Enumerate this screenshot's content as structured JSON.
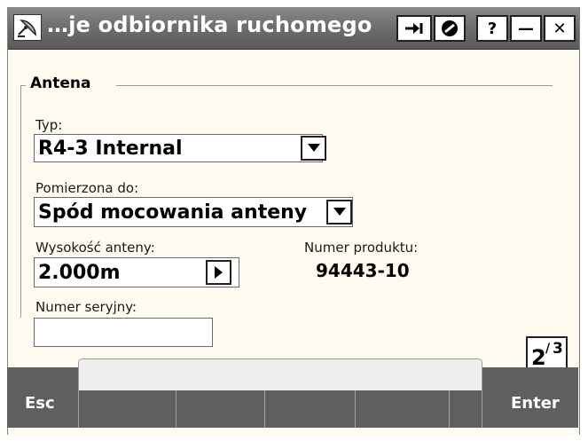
{
  "window": {
    "title": "…je odbiornika ruchomego",
    "buttons": {
      "help": "?",
      "minimize": "—",
      "close": "✕"
    }
  },
  "icons": {
    "app": "satellite-dish-icon",
    "forward": "arrow-right-icon",
    "no_entry": "no-entry-icon",
    "dropdown": "triangle-down-icon",
    "play": "triangle-right-icon"
  },
  "antenna": {
    "group_title": "Antena",
    "type_label": "Typ:",
    "type_value": "R4-3 Internal",
    "measured_to_label": "Pomierzona do:",
    "measured_to_value": "Spód mocowania anteny",
    "height_label": "Wysokość anteny:",
    "height_value": "2.000m",
    "product_number_label": "Numer produktu:",
    "product_number_value": "94443-10",
    "serial_label": "Numer seryjny:",
    "serial_value": ""
  },
  "pager": {
    "current": "2",
    "total": "3"
  },
  "softkeys": {
    "esc": "Esc",
    "enter": "Enter"
  },
  "colors": {
    "titlebar": "#707070",
    "form_background": "#fffbf0",
    "bottom_bar": "#5f5f5f"
  }
}
